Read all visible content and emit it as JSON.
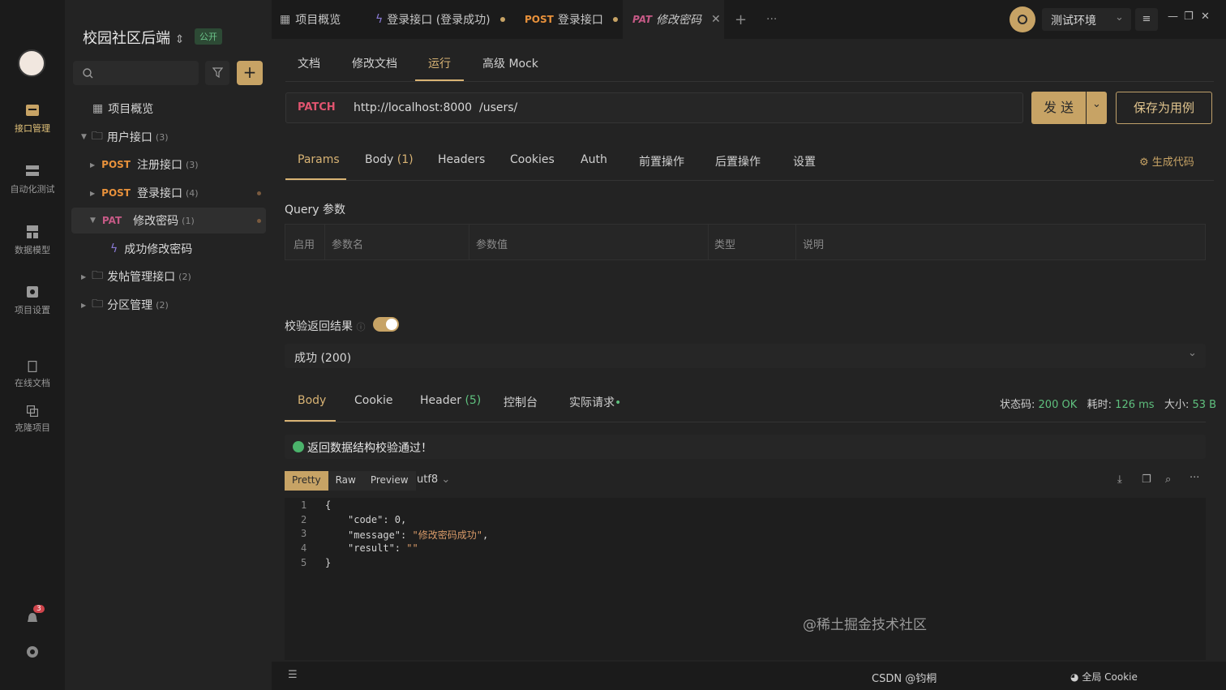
{
  "rail": {
    "items": [
      {
        "label": "接口管理",
        "icon": "api-icon"
      },
      {
        "label": "自动化测试",
        "icon": "automation-icon"
      },
      {
        "label": "数据模型",
        "icon": "data-model-icon"
      },
      {
        "label": "项目设置",
        "icon": "settings-icon"
      },
      {
        "label": "在线文档",
        "icon": "doc-icon"
      },
      {
        "label": "克隆项目",
        "icon": "clone-icon"
      }
    ],
    "notification_count": "3"
  },
  "tree": {
    "project_title": "校园社区后端",
    "badge": "公开",
    "overview": "项目概览",
    "folders": [
      {
        "label": "用户接口",
        "count": "(3)"
      },
      {
        "label": "发帖管理接口",
        "count": "(2)"
      },
      {
        "label": "分区管理",
        "count": "(2)"
      }
    ],
    "items": [
      {
        "method": "POST",
        "label": "注册接口",
        "count": "(3)"
      },
      {
        "method": "POST",
        "label": "登录接口",
        "count": "(4)"
      },
      {
        "method": "PAT",
        "label": "修改密码",
        "count": "(1)"
      }
    ],
    "case": "成功修改密码"
  },
  "tabs": [
    {
      "label": "项目概览"
    },
    {
      "label": "登录接口 (登录成功)"
    },
    {
      "method": "POST",
      "label": "登录接口"
    },
    {
      "method": "PAT",
      "label": "修改密码"
    }
  ],
  "env": {
    "label": "测试环境"
  },
  "subtabs": [
    "文档",
    "修改文档",
    "运行",
    "高级 Mock"
  ],
  "request": {
    "method": "PATCH",
    "base_url": "http://localhost:8000",
    "path": "/users/",
    "send": "发 送",
    "save_case": "保存为用例"
  },
  "param_tabs": {
    "params": "Params",
    "body": "Body",
    "body_count": "(1)",
    "headers": "Headers",
    "cookies": "Cookies",
    "auth": "Auth",
    "pre": "前置操作",
    "post": "后置操作",
    "settings": "设置",
    "gencode": "生成代码"
  },
  "query": {
    "title": "Query 参数",
    "columns": [
      "启用",
      "参数名",
      "参数值",
      "类型",
      "说明"
    ]
  },
  "validation": {
    "label": "校验返回结果",
    "selected": "成功 (200)",
    "ok_message": "返回数据结构校验通过！"
  },
  "response_tabs": {
    "body": "Body",
    "cookie": "Cookie",
    "header": "Header",
    "header_count": "(5)",
    "console": "控制台",
    "actual": "实际请求"
  },
  "response_meta": {
    "status_label": "状态码:",
    "status": "200 OK",
    "time_label": "耗时:",
    "time": "126 ms",
    "size_label": "大小:",
    "size": "53 B"
  },
  "view": {
    "pretty": "Pretty",
    "raw": "Raw",
    "preview": "Preview",
    "encoding": "utf8"
  },
  "code_lines": [
    {
      "n": "1",
      "text": "{"
    },
    {
      "n": "2",
      "key": "\"code\"",
      "val": ": 0,"
    },
    {
      "n": "3",
      "key": "\"message\"",
      "str": "\"修改密码成功\"",
      "tail": ","
    },
    {
      "n": "4",
      "key": "\"result\"",
      "str": "\"\"",
      "tail": ""
    },
    {
      "n": "5",
      "text": "}"
    }
  ],
  "footer": {
    "cookie": "全局 Cookie",
    "watermark": "@稀土掘金技术社区",
    "watermark2": "CSDN @钧桐"
  }
}
